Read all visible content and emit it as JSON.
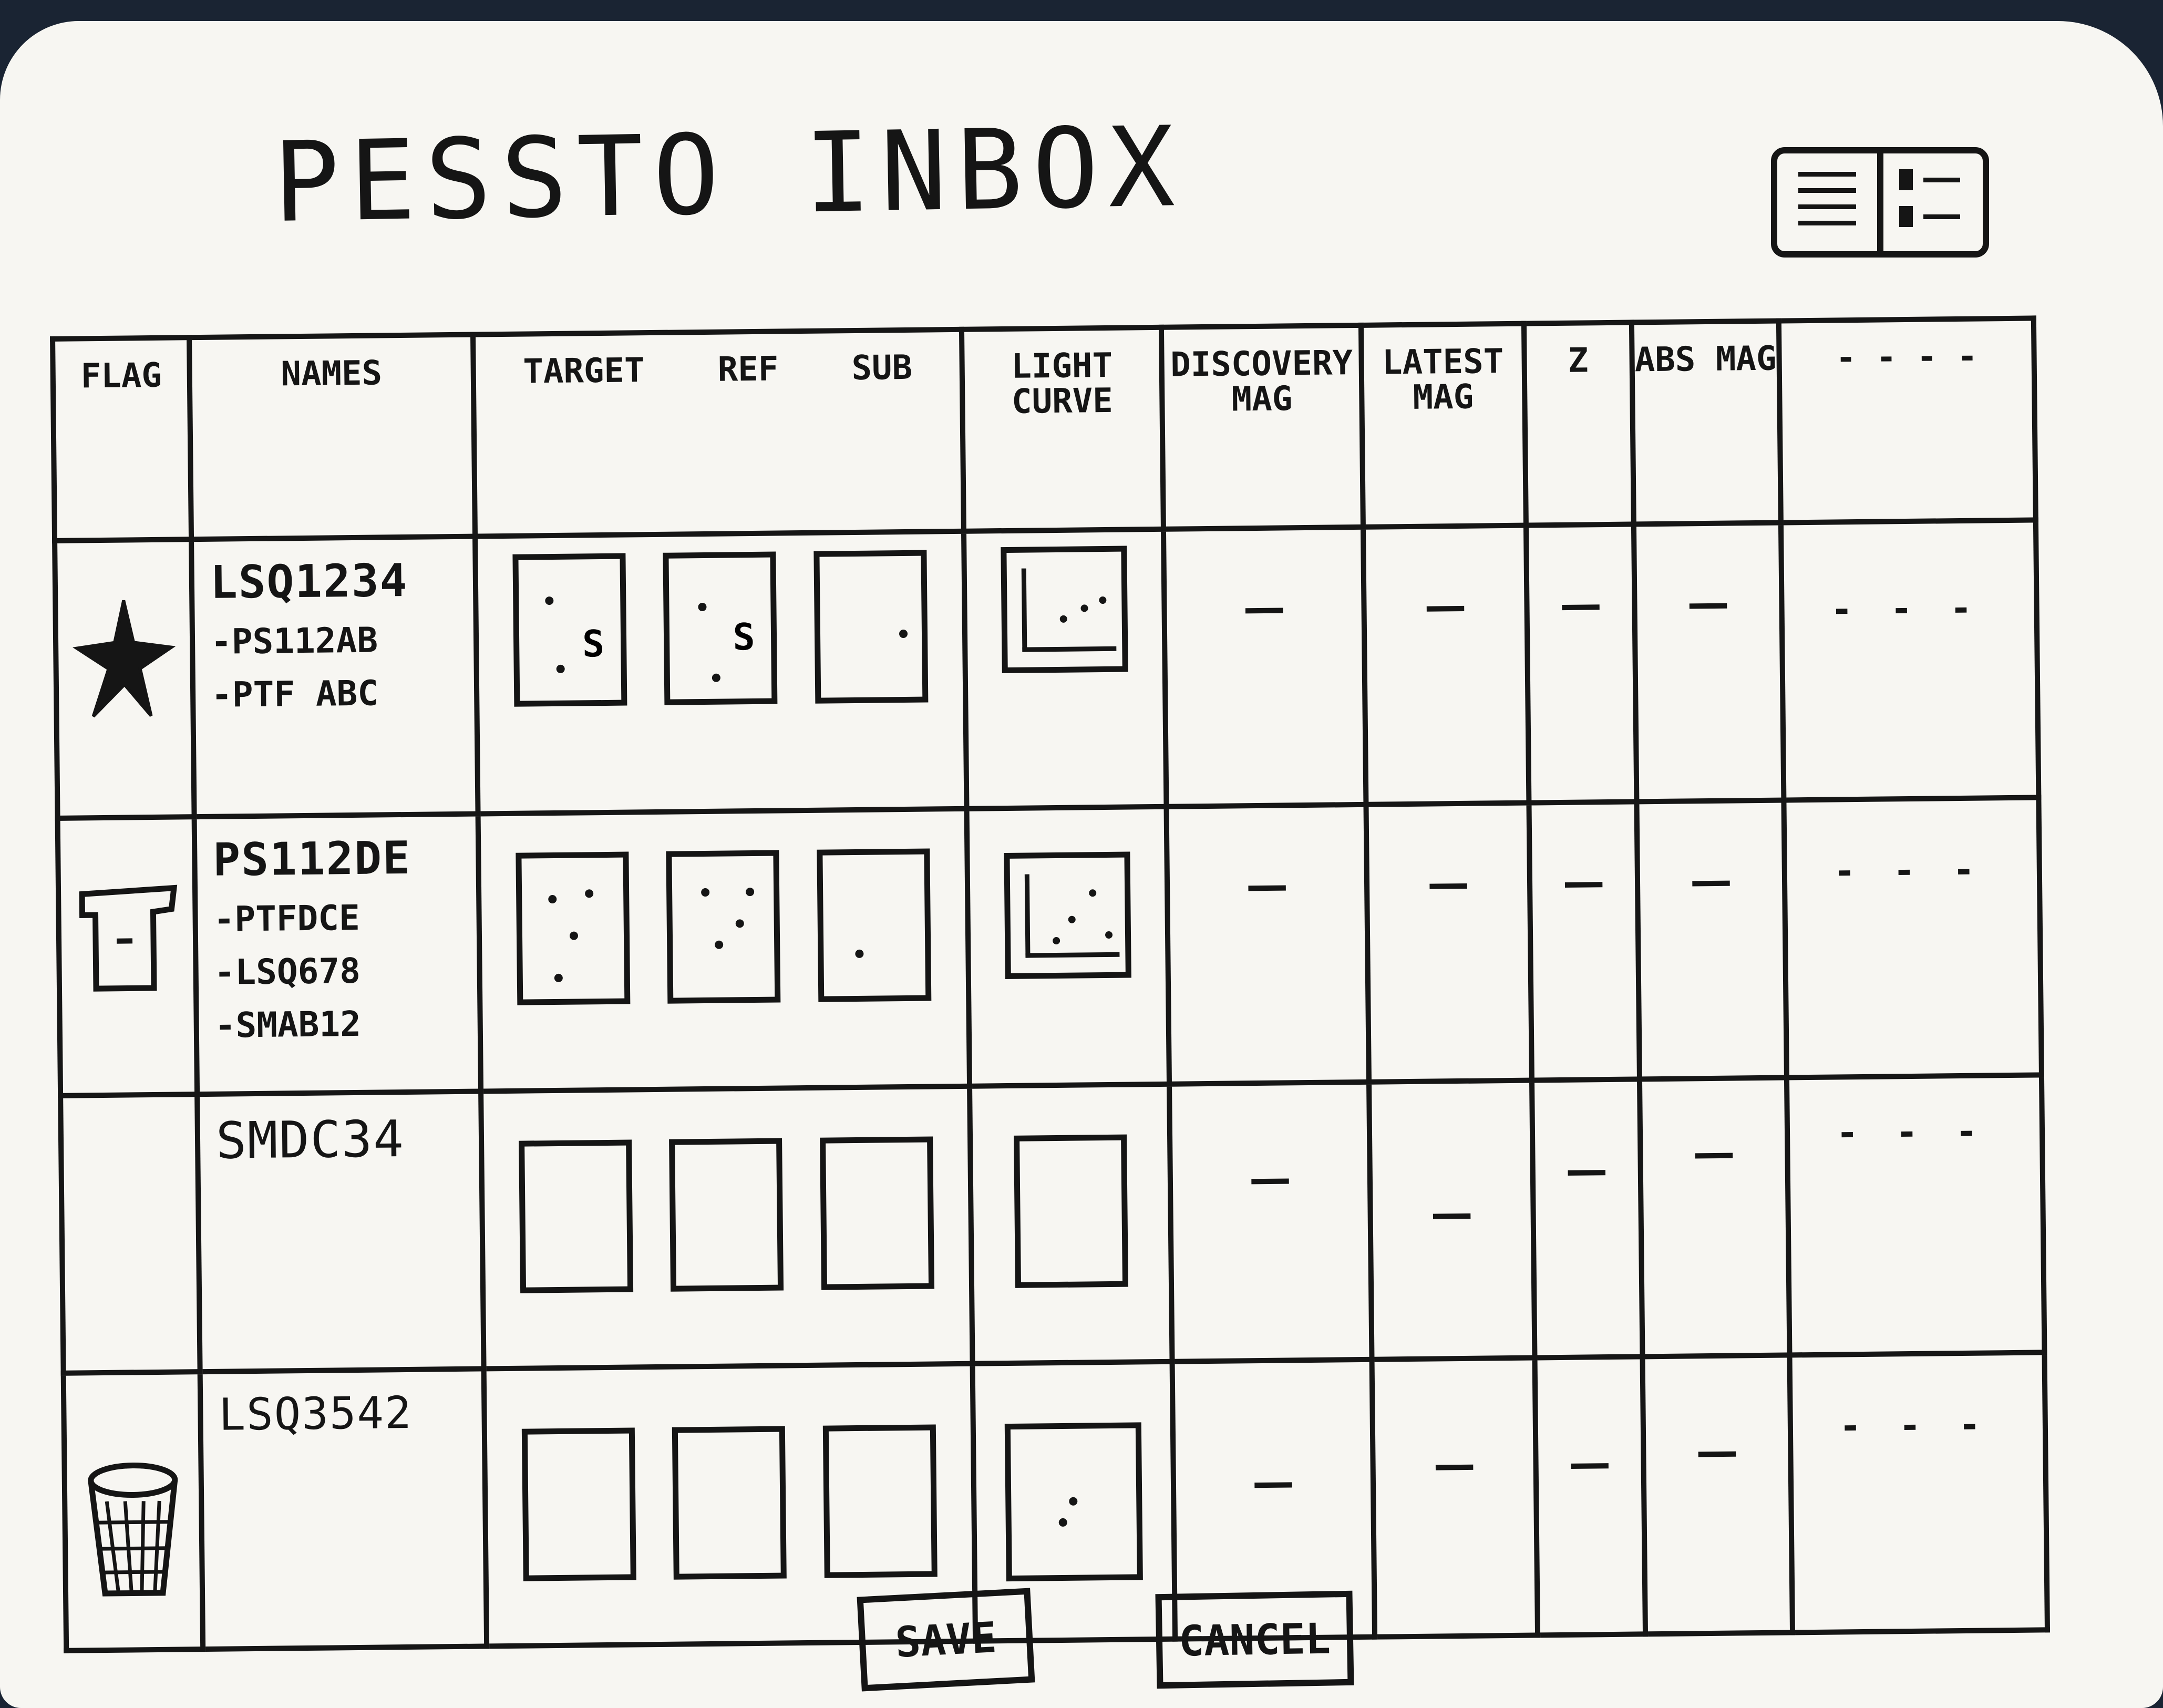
{
  "app": {
    "title": "PESSTO INBOX"
  },
  "view_toggle": {
    "icon_left": "list-view-icon",
    "icon_right": "card-view-icon"
  },
  "table": {
    "headers": {
      "flag": "FLAG",
      "names": "NAMES",
      "stamps": [
        "TARGET",
        "REF",
        "SUB"
      ],
      "light_curve": "LIGHT CURVE",
      "discovery_mag": "DISCOVERY MAG",
      "latest_mag": "LATEST MAG",
      "z": "Z",
      "abs_mag": "ABS MAG",
      "extra": "- - - -"
    },
    "rows": [
      {
        "flag_icon": "star-icon",
        "primary": "LSQ1234",
        "aliases": [
          "-PS112AB",
          "-PTF ABC"
        ],
        "discovery_mag": "—",
        "latest_mag": "—",
        "z": "—",
        "abs_mag": "—",
        "extra": "- - -"
      },
      {
        "flag_icon": "pin-icon",
        "primary": "PS112DE",
        "aliases": [
          "-PTFDCE",
          "-LSQ678",
          "-SMAB12"
        ],
        "discovery_mag": "—",
        "latest_mag": "—",
        "z": "—",
        "abs_mag": "—",
        "extra": "- - -"
      },
      {
        "flag_icon": "",
        "primary": "SMDC34",
        "aliases": [],
        "discovery_mag": "—",
        "latest_mag": "—",
        "z": "—",
        "abs_mag": "—",
        "extra": "- - -"
      },
      {
        "flag_icon": "trash-icon",
        "primary": "LSQ3542",
        "aliases": [],
        "discovery_mag": "—",
        "latest_mag": "—",
        "z": "—",
        "abs_mag": "—",
        "extra": "- - -"
      }
    ]
  },
  "buttons": {
    "save": "SAVE",
    "cancel": "CANCEL"
  }
}
